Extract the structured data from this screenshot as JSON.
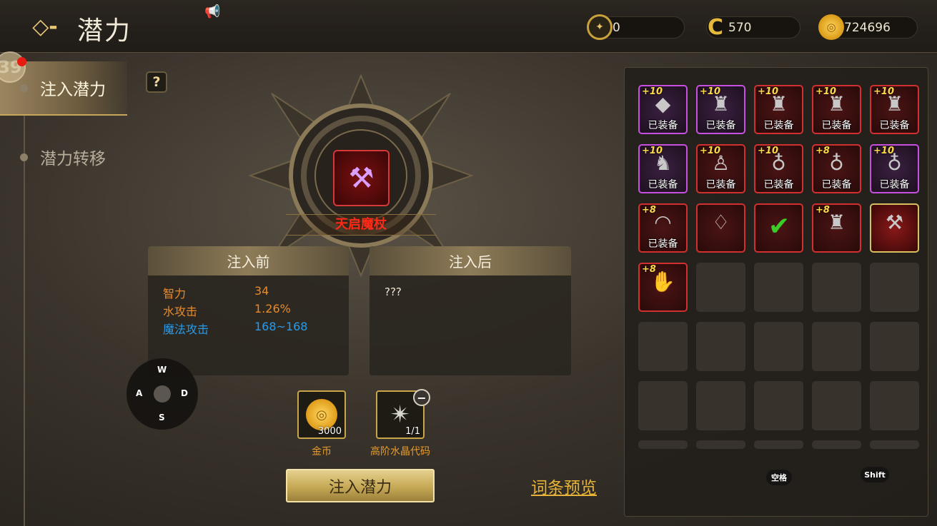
{
  "header": {
    "back_glyph": "◇-",
    "title": "潜力",
    "currencies": [
      {
        "icon": "target-coin-icon",
        "glyph": "✦",
        "value": "0"
      },
      {
        "icon": "c-coin-icon",
        "glyph": "C",
        "value": "570"
      },
      {
        "icon": "gold-coin-icon",
        "glyph": "◎",
        "value": "724696"
      }
    ]
  },
  "nav": {
    "level": "39",
    "items": [
      {
        "label": "注入潜力",
        "active": true
      },
      {
        "label": "潜力转移",
        "active": false
      }
    ],
    "help": "?"
  },
  "weapon": {
    "name": "天启魔杖",
    "glyph": "⚒"
  },
  "before": {
    "title": "注入前",
    "stats": [
      {
        "name": "智力",
        "value": "34",
        "color": "#e88a2a"
      },
      {
        "name": "水攻击",
        "value": "1.26%",
        "color": "#e88a2a"
      },
      {
        "name": "魔法攻击",
        "value": "168~168",
        "color": "#2a9ae8"
      }
    ]
  },
  "after": {
    "title": "注入后",
    "text": "???"
  },
  "wasd": {
    "w": "W",
    "a": "A",
    "s": "S",
    "d": "D"
  },
  "materials": {
    "gold": {
      "label": "金币",
      "count": "3000"
    },
    "crystal": {
      "label": "高阶水晶代码",
      "count": "1/1"
    },
    "minus": "−"
  },
  "actions": {
    "inject": "注入潜力",
    "preview": "词条预览"
  },
  "inventory": {
    "equipped_label": "已装备",
    "items": [
      {
        "lvl": "+10",
        "art": "◆",
        "rarity": "purple",
        "equipped": true
      },
      {
        "lvl": "+10",
        "art": "♜",
        "rarity": "purple",
        "equipped": true
      },
      {
        "lvl": "+10",
        "art": "♜",
        "rarity": "red",
        "equipped": true
      },
      {
        "lvl": "+10",
        "art": "♜",
        "rarity": "red",
        "equipped": true
      },
      {
        "lvl": "+10",
        "art": "♜",
        "rarity": "red",
        "equipped": true
      },
      {
        "lvl": "+10",
        "art": "♞",
        "rarity": "purple",
        "equipped": true
      },
      {
        "lvl": "+10",
        "art": "♙",
        "rarity": "red",
        "equipped": true
      },
      {
        "lvl": "+10",
        "art": "♁",
        "rarity": "red",
        "equipped": true
      },
      {
        "lvl": "+8",
        "art": "♁",
        "rarity": "red",
        "equipped": true
      },
      {
        "lvl": "+10",
        "art": "♁",
        "rarity": "purple",
        "equipped": true
      },
      {
        "lvl": "+8",
        "art": "◠",
        "rarity": "red",
        "equipped": true
      },
      {
        "lvl": "",
        "art": "♢",
        "rarity": "red",
        "equipped": false
      },
      {
        "lvl": "",
        "art": "✔",
        "rarity": "red",
        "equipped": false
      },
      {
        "lvl": "+8",
        "art": "♜",
        "rarity": "red",
        "equipped": false
      },
      {
        "lvl": "",
        "art": "⚒",
        "rarity": "gold",
        "equipped": false
      },
      {
        "lvl": "+8",
        "art": "✋",
        "rarity": "red",
        "equipped": false
      }
    ]
  },
  "keys": {
    "space": "空格",
    "shift": "Shift"
  }
}
